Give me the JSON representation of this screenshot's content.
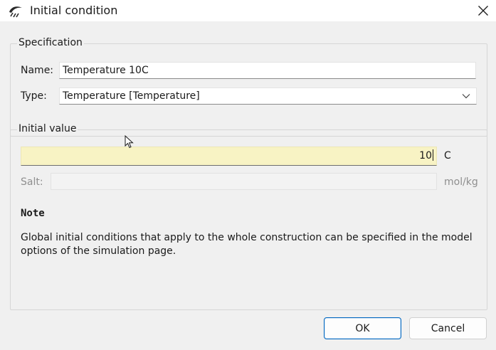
{
  "window": {
    "title": "Initial condition",
    "app_icon": "stream-logo-icon",
    "close_icon": "close-icon"
  },
  "specification": {
    "legend": "Specification",
    "name_label": "Name:",
    "name_value": "Temperature 10C",
    "type_label": "Type:",
    "type_value": "Temperature [Temperature]"
  },
  "initial_value": {
    "legend": "Initial value",
    "value": "10",
    "unit": "C",
    "salt_label": "Salt:",
    "salt_value": "",
    "salt_unit": "mol/kg"
  },
  "note": {
    "title": "Note",
    "text": "Global initial conditions that apply to the whole construction can be specified in the model options of the simulation page."
  },
  "buttons": {
    "ok": "OK",
    "cancel": "Cancel"
  },
  "colors": {
    "active_field": "#f8f3c4",
    "default_button_border": "#0067c0"
  }
}
